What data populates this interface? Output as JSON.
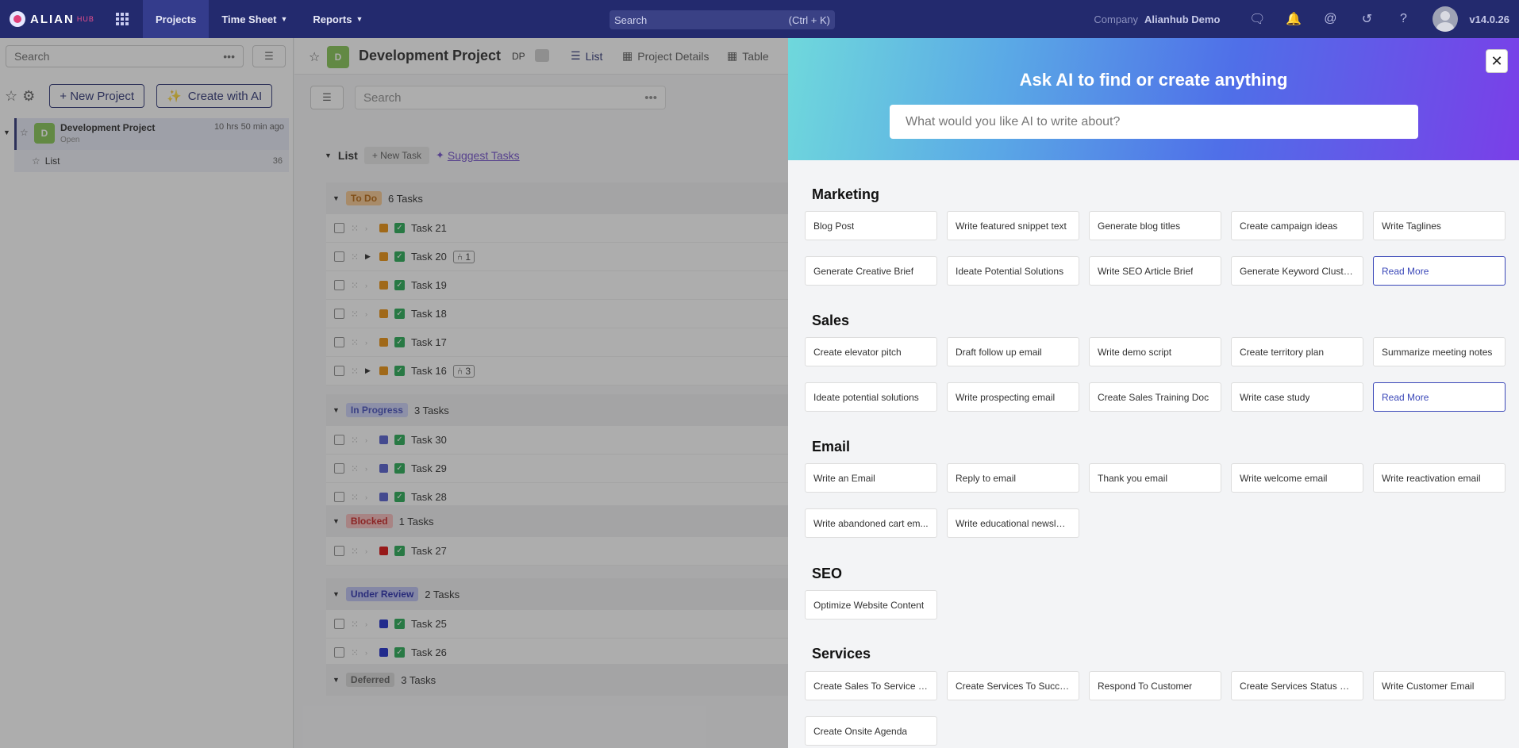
{
  "topbar": {
    "logo_text": "ALIAN",
    "logo_sub": "HUB",
    "nav": [
      {
        "label": "Projects"
      },
      {
        "label": "Time Sheet"
      },
      {
        "label": "Reports"
      }
    ],
    "search_placeholder": "Search",
    "search_shortcut": "(Ctrl + K)",
    "company_label": "Company",
    "company_name": "Alianhub Demo",
    "version": "v14.0.26"
  },
  "sidebar": {
    "search_placeholder": "Search",
    "new_project_label": "+ New Project",
    "create_ai_label": "Create with AI",
    "project": {
      "badge": "D",
      "name": "Development Project",
      "status": "Open",
      "time": "10 hrs 50 min ago"
    },
    "list": {
      "label": "List",
      "count": "36"
    }
  },
  "main": {
    "header": {
      "badge": "D",
      "title": "Development Project",
      "code": "DP",
      "tabs": [
        {
          "label": "List"
        },
        {
          "label": "Project Details"
        },
        {
          "label": "Table"
        }
      ]
    },
    "search_placeholder": "Search",
    "list_label": "List",
    "new_task_label": "+ New Task",
    "suggest_label": "Suggest Tasks",
    "groups": [
      {
        "status": "To Do",
        "count": "6 Tasks",
        "chip_bg": "#f6c48a",
        "chip_fg": "#b25d00",
        "sq": "#e88a00",
        "tasks": [
          {
            "name": "Task 21",
            "sub": "",
            "expand": false
          },
          {
            "name": "Task 20",
            "sub": "1",
            "expand": true
          },
          {
            "name": "Task 19",
            "sub": "",
            "expand": false
          },
          {
            "name": "Task 18",
            "sub": "",
            "expand": false
          },
          {
            "name": "Task 17",
            "sub": "",
            "expand": false
          },
          {
            "name": "Task 16",
            "sub": "3",
            "expand": true
          }
        ]
      },
      {
        "status": "In Progress",
        "count": "3 Tasks",
        "chip_bg": "#c9cef7",
        "chip_fg": "#3b46b8",
        "sq": "#4b55cc",
        "tasks": [
          {
            "name": "Task 30",
            "sub": "",
            "expand": false
          },
          {
            "name": "Task 29",
            "sub": "",
            "expand": false
          },
          {
            "name": "Task 28",
            "sub": "",
            "expand": false
          }
        ]
      },
      {
        "status": "Blocked",
        "count": "1 Tasks",
        "chip_bg": "#f7b8b8",
        "chip_fg": "#c41515",
        "sq": "#d90000",
        "tasks": [
          {
            "name": "Task 27",
            "sub": "",
            "expand": false
          }
        ]
      },
      {
        "status": "Under Review",
        "count": "2 Tasks",
        "chip_bg": "#b9bdf2",
        "chip_fg": "#1d22a8",
        "sq": "#1020c8",
        "tasks": [
          {
            "name": "Task 25",
            "sub": "",
            "expand": false
          },
          {
            "name": "Task 26",
            "sub": "",
            "expand": false
          }
        ]
      },
      {
        "status": "Deferred",
        "count": "3 Tasks",
        "chip_bg": "#d6d6d6",
        "chip_fg": "#555555",
        "sq": "#888888",
        "tasks": []
      }
    ]
  },
  "ai_panel": {
    "title": "Ask AI to find or create anything",
    "input_placeholder": "What would you like AI to write about?",
    "close_glyph": "✕",
    "sections": [
      {
        "title": "Marketing",
        "items": [
          "Blog Post",
          "Write featured snippet text",
          "Generate blog titles",
          "Create campaign ideas",
          "Write Taglines",
          "Generate Creative Brief",
          "Ideate Potential Solutions",
          "Write SEO Article Brief",
          "Generate Keyword Clusters",
          "Read More"
        ]
      },
      {
        "title": "Sales",
        "items": [
          "Create elevator pitch",
          "Draft follow up email",
          "Write demo script",
          "Create territory plan",
          "Summarize meeting notes",
          "Ideate potential solutions",
          "Write prospecting email",
          "Create Sales Training Doc",
          "Write case study",
          "Read More"
        ]
      },
      {
        "title": "Email",
        "items": [
          "Write an Email",
          "Reply to email",
          "Thank you email",
          "Write welcome email",
          "Write reactivation email",
          "Write abandoned cart em...",
          "Write educational newslet..."
        ]
      },
      {
        "title": "SEO",
        "items": [
          "Optimize Website Content"
        ]
      },
      {
        "title": "Services",
        "items": [
          "Create Sales To Service H...",
          "Create Services To Succe...",
          "Respond To Customer",
          "Create Services Status Re...",
          "Write Customer Email",
          "Create Onsite Agenda"
        ]
      }
    ]
  }
}
